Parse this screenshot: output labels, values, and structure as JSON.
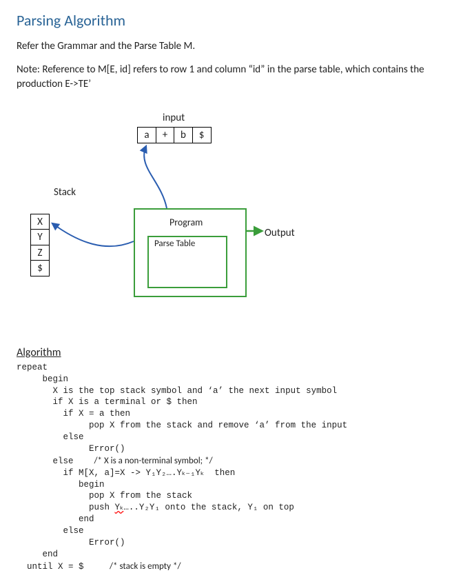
{
  "title": "Parsing Algorithm",
  "intro": "Refer the Grammar and the Parse Table M.",
  "note": "Note: Reference to M[E, id] refers to row 1 and column “id” in the parse table, which contains the production E->TE’",
  "diagram": {
    "inputLabel": "input",
    "inputCells": [
      "a",
      "+",
      "b",
      "$"
    ],
    "stackLabel": "Stack",
    "stackCells": [
      "X",
      "Y",
      "Z",
      "$"
    ],
    "programLabel": "Program",
    "parseTableLabel": "Parse Table",
    "outputLabel": "Output"
  },
  "algoHeading": "Algorithm",
  "algo": {
    "l1": "repeat",
    "l2": "     begin",
    "l3": "       X is the top stack symbol and ‘a’ the next input symbol",
    "l4": "       if X is a terminal or $ then",
    "l5": "         if X = a then",
    "l6": "              pop X from the stack and remove ‘a’ from the input",
    "l7": "         else",
    "l8": "              Error()",
    "l9a": "       else    ",
    "l9b": "/* X is a non-terminal symbol; */",
    "l10": "         if M[X, a]=X -> Y₁Y₂….Yₖ₋₁Yₖ  then",
    "l11": "            begin",
    "l12": "              pop X from the stack",
    "l13a": "              push ",
    "l13b": "Yₖ",
    "l13c": "…..Y₂Y₁ onto the stack, Y₁ on top",
    "l14": "            end",
    "l15": "         else",
    "l16": "              Error()",
    "l17": "     end",
    "l18a": "  until X = $     ",
    "l18b": "/* stack is empty */"
  }
}
